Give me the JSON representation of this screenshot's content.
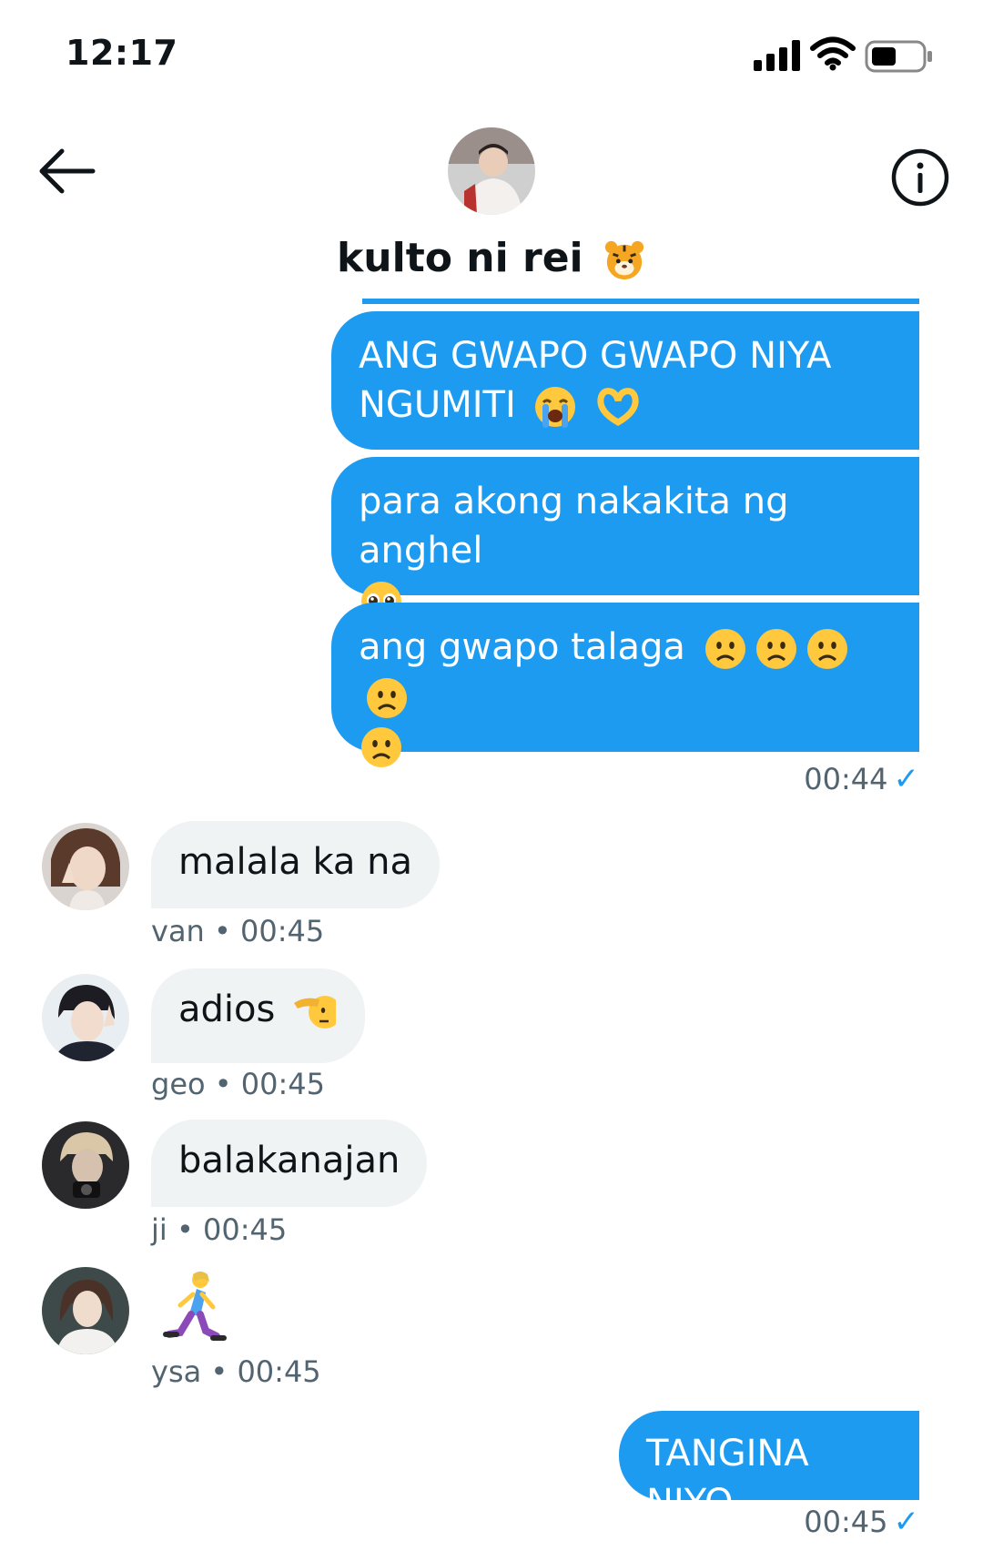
{
  "status_bar": {
    "time": "12:17"
  },
  "header": {
    "title": "kulto ni rei"
  },
  "messages": {
    "sent1": {
      "text": "ANG GWAPO GWAPO NIYA NGUMITI"
    },
    "sent2": {
      "text": "para akong nakakita ng anghel"
    },
    "sent3": {
      "text": "ang gwapo talaga"
    },
    "sent_time_1": "00:44",
    "van": {
      "text": "malala ka na",
      "name": "van",
      "time": "00:45"
    },
    "geo": {
      "text": "adios",
      "name": "geo",
      "time": "00:45"
    },
    "ji": {
      "text": "balakanajan",
      "name": "ji",
      "time": "00:45"
    },
    "ysa": {
      "name": "ysa",
      "time": "00:45"
    },
    "sent4": {
      "text": "TANGINA NIYO",
      "time": "00:45"
    }
  },
  "icons": [
    "back-arrow-icon",
    "info-icon",
    "signal-icon",
    "wifi-icon",
    "battery-icon",
    "check-icon",
    "tiger-emoji",
    "crying-emoji",
    "heart-hands-emoji",
    "pleading-emoji",
    "frowning-emoji",
    "saluting-emoji",
    "running-woman-emoji"
  ],
  "colors": {
    "accent": "#1d9bf0",
    "received_bubble": "#eff3f4",
    "muted_text": "#536471"
  }
}
